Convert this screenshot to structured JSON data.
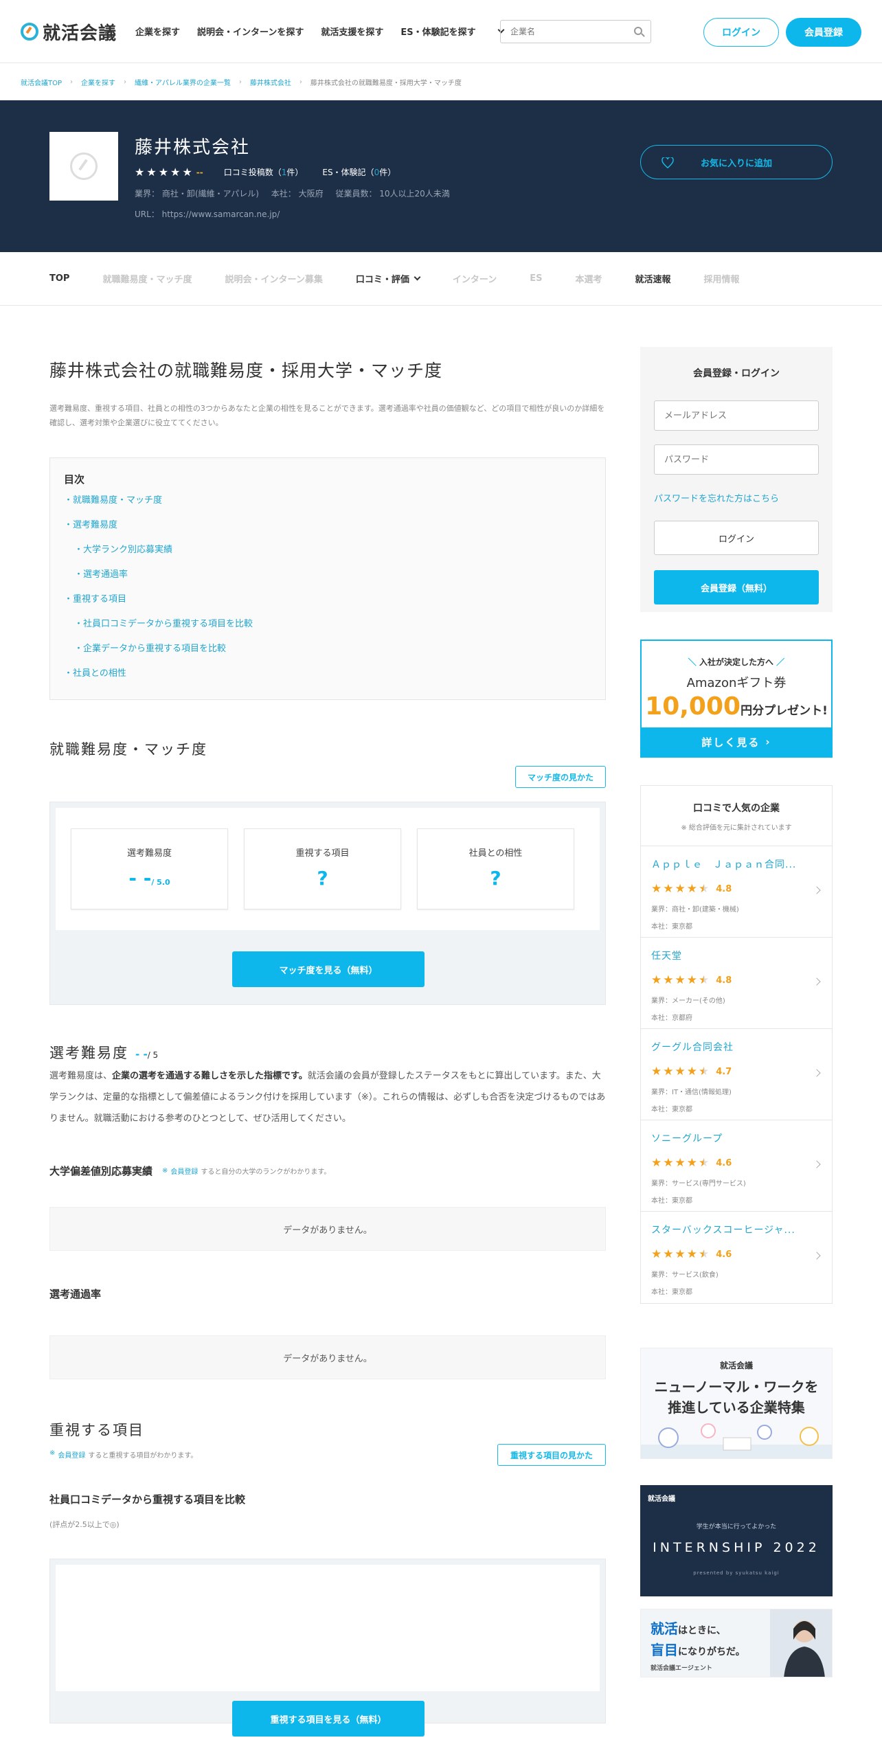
{
  "header": {
    "logo_text": "就活会議",
    "nav": [
      "企業を探す",
      "説明会・インターンを探す",
      "就活支援を探す",
      "ES・体験記を探す"
    ],
    "search_placeholder": "企業名",
    "login_label": "ログイン",
    "register_label": "会員登録"
  },
  "breadcrumb": [
    "就活会議TOP",
    "企業を探す",
    "繊維・アパレル業界の企業一覧",
    "藤井株式会社",
    "藤井株式会社の就職難易度・採用大学・マッチ度"
  ],
  "company": {
    "name": "藤井株式会社",
    "rating": "--",
    "review_label": "口コミ投稿数（",
    "review_count": "1",
    "review_suffix": "件）",
    "es_label": "ES・体験記（",
    "es_count": "0",
    "es_suffix": "件）",
    "industry": "業界： 商社・卸(繊維・アパレル)",
    "hq": "本社： 大阪府",
    "employees": "従業員数： 10人以上20人未満",
    "url": "URL： https://www.samarcan.ne.jp/",
    "fav_label": "お気に入りに追加"
  },
  "tabs": [
    "TOP",
    "就職難易度・マッチ度",
    "説明会・インターン募集",
    "口コミ・評価",
    "インターン",
    "ES",
    "本選考",
    "就活速報",
    "採用情報"
  ],
  "main": {
    "title": "藤井株式会社の就職難易度・採用大学・マッチ度",
    "lead": "選考難易度、重視する項目、社員との相性の3つからあなたと企業の相性を見ることができます。選考通過率や社員の価値観など、どの項目で相性が良いのか詳細を確認し、選考対策や企業選びに役立ててください。",
    "toc_title": "目次",
    "toc": [
      {
        "label": "・就職難易度・マッチ度",
        "sub": false
      },
      {
        "label": "・選考難易度",
        "sub": false
      },
      {
        "label": "・大学ランク別応募実績",
        "sub": true
      },
      {
        "label": "・選考通過率",
        "sub": true
      },
      {
        "label": "・重視する項目",
        "sub": false
      },
      {
        "label": "・社員口コミデータから重視する項目を比較",
        "sub": true
      },
      {
        "label": "・企業データから重視する項目を比較",
        "sub": true
      },
      {
        "label": "・社員との相性",
        "sub": false
      }
    ],
    "match_heading": "就職難易度・マッチ度",
    "match_howto": "マッチ度の見かた",
    "cards": [
      {
        "label": "選考難易度",
        "value": "- -",
        "unit": "/ 5.0"
      },
      {
        "label": "重視する項目",
        "value": "?",
        "unit": ""
      },
      {
        "label": "社員との相性",
        "value": "?",
        "unit": ""
      }
    ],
    "match_cta": "マッチ度を見る（無料）",
    "diff_heading": "選考難易度",
    "diff_score": "- -",
    "diff_max": "/ 5",
    "diff_text_1": "選考難易度は、",
    "diff_text_bold": "企業の選考を通過する難しさを示した指標です。",
    "diff_text_2": "就活会議の会員が登録したステータスをもとに算出しています。また、大学ランクは、定量的な指標として偏差値によるランク付けを採用しています（※）。これらの情報は、必ずしも合否を決定づけるものではありません。就職活動における参考のひとつとして、ぜひ活用してください。",
    "univ_heading": "大学偏差値別応募実績",
    "univ_note_pre": "※",
    "univ_note_link": "会員登録",
    "univ_note_post": "すると自分の大学のランクがわかります。",
    "nodata": "データがありません。",
    "pass_heading": "選考通過率",
    "values_heading": "重視する項目",
    "values_note_pre": "※",
    "values_note_link": "会員登録",
    "values_note_post": "すると重視する項目がわかります。",
    "values_howto": "重視する項目の見かた",
    "compare_heading": "社員口コミデータから重視する項目を比較",
    "compare_note": "(評点が2.5以上で◎)",
    "compare_cta": "重視する項目を見る（無料）"
  },
  "sidebar": {
    "login_title": "会員登録・ログイン",
    "email_placeholder": "メールアドレス",
    "password_placeholder": "パスワード",
    "forgot": "パスワードを忘れた方はこちら",
    "login_btn": "ログイン",
    "register_btn": "会員登録（無料）",
    "amazon": {
      "line1": "入社が決定した方へ",
      "line2": "Amazonギフト券",
      "amount": "10,000",
      "suffix": "円分プレゼント!",
      "cta": "詳しく見る"
    },
    "popular_title": "口コミで人気の企業",
    "popular_note": "※ 総合評価を元に集計されています",
    "popular": [
      {
        "name": "Ａｐｐｌｅ　Ｊａｐａｎ合同...",
        "rating": 4.8,
        "score": "4.8",
        "industry": "業界：商社・卸(建築・機械)",
        "hq": "本社：東京都"
      },
      {
        "name": "任天堂",
        "rating": 4.8,
        "score": "4.8",
        "industry": "業界：メーカー(その他)",
        "hq": "本社：京都府"
      },
      {
        "name": "グーグル合同会社",
        "rating": 4.7,
        "score": "4.7",
        "industry": "業界：IT・通信(情報処理)",
        "hq": "本社：東京都"
      },
      {
        "name": "ソニーグループ",
        "rating": 4.6,
        "score": "4.6",
        "industry": "業界：サービス(専門サービス)",
        "hq": "本社：東京都"
      },
      {
        "name": "スターバックスコーヒージャ...",
        "rating": 4.6,
        "score": "4.6",
        "industry": "業界：サービス(飲食)",
        "hq": "本社：東京都"
      }
    ],
    "banner1": {
      "brand": "就活会議",
      "line1": "ニューノーマル・ワークを",
      "line2": "推進している企業特集"
    },
    "banner2": {
      "brand": "就活会議",
      "sub": "学生が本当に行ってよかった",
      "title": "INTERNSHIP 2022",
      "credit": "presented by syukatsu kaigi"
    },
    "banner3": {
      "line1a": "就活",
      "line1b": "はときに、",
      "line2a": "盲目",
      "line2b": "になりがちだ。",
      "brand": "就活会議エージェント"
    }
  },
  "colors": {
    "accent": "#0db7eb",
    "hero_bg": "#1d2e47",
    "star": "#f3a01b"
  }
}
